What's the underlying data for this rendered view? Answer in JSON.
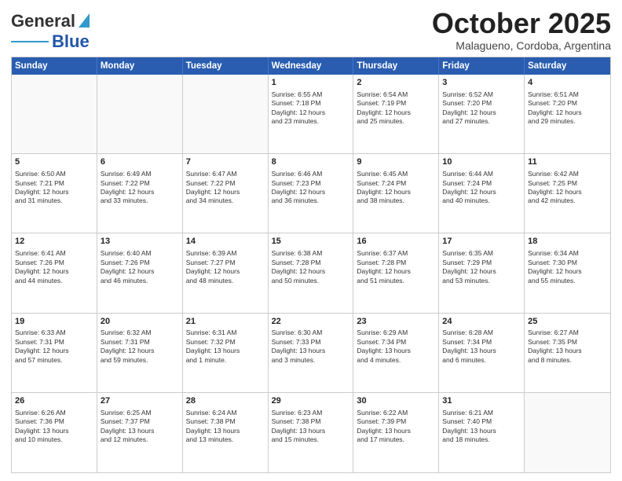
{
  "header": {
    "logo": {
      "general": "General",
      "blue": "Blue",
      "tagline": "Blue"
    },
    "title": "October 2025",
    "location": "Malagueno, Cordoba, Argentina"
  },
  "weekdays": [
    "Sunday",
    "Monday",
    "Tuesday",
    "Wednesday",
    "Thursday",
    "Friday",
    "Saturday"
  ],
  "weeks": [
    [
      {
        "day": "",
        "info": ""
      },
      {
        "day": "",
        "info": ""
      },
      {
        "day": "",
        "info": ""
      },
      {
        "day": "1",
        "info": "Sunrise: 6:55 AM\nSunset: 7:18 PM\nDaylight: 12 hours\nand 23 minutes."
      },
      {
        "day": "2",
        "info": "Sunrise: 6:54 AM\nSunset: 7:19 PM\nDaylight: 12 hours\nand 25 minutes."
      },
      {
        "day": "3",
        "info": "Sunrise: 6:52 AM\nSunset: 7:20 PM\nDaylight: 12 hours\nand 27 minutes."
      },
      {
        "day": "4",
        "info": "Sunrise: 6:51 AM\nSunset: 7:20 PM\nDaylight: 12 hours\nand 29 minutes."
      }
    ],
    [
      {
        "day": "5",
        "info": "Sunrise: 6:50 AM\nSunset: 7:21 PM\nDaylight: 12 hours\nand 31 minutes."
      },
      {
        "day": "6",
        "info": "Sunrise: 6:49 AM\nSunset: 7:22 PM\nDaylight: 12 hours\nand 33 minutes."
      },
      {
        "day": "7",
        "info": "Sunrise: 6:47 AM\nSunset: 7:22 PM\nDaylight: 12 hours\nand 34 minutes."
      },
      {
        "day": "8",
        "info": "Sunrise: 6:46 AM\nSunset: 7:23 PM\nDaylight: 12 hours\nand 36 minutes."
      },
      {
        "day": "9",
        "info": "Sunrise: 6:45 AM\nSunset: 7:24 PM\nDaylight: 12 hours\nand 38 minutes."
      },
      {
        "day": "10",
        "info": "Sunrise: 6:44 AM\nSunset: 7:24 PM\nDaylight: 12 hours\nand 40 minutes."
      },
      {
        "day": "11",
        "info": "Sunrise: 6:42 AM\nSunset: 7:25 PM\nDaylight: 12 hours\nand 42 minutes."
      }
    ],
    [
      {
        "day": "12",
        "info": "Sunrise: 6:41 AM\nSunset: 7:26 PM\nDaylight: 12 hours\nand 44 minutes."
      },
      {
        "day": "13",
        "info": "Sunrise: 6:40 AM\nSunset: 7:26 PM\nDaylight: 12 hours\nand 46 minutes."
      },
      {
        "day": "14",
        "info": "Sunrise: 6:39 AM\nSunset: 7:27 PM\nDaylight: 12 hours\nand 48 minutes."
      },
      {
        "day": "15",
        "info": "Sunrise: 6:38 AM\nSunset: 7:28 PM\nDaylight: 12 hours\nand 50 minutes."
      },
      {
        "day": "16",
        "info": "Sunrise: 6:37 AM\nSunset: 7:28 PM\nDaylight: 12 hours\nand 51 minutes."
      },
      {
        "day": "17",
        "info": "Sunrise: 6:35 AM\nSunset: 7:29 PM\nDaylight: 12 hours\nand 53 minutes."
      },
      {
        "day": "18",
        "info": "Sunrise: 6:34 AM\nSunset: 7:30 PM\nDaylight: 12 hours\nand 55 minutes."
      }
    ],
    [
      {
        "day": "19",
        "info": "Sunrise: 6:33 AM\nSunset: 7:31 PM\nDaylight: 12 hours\nand 57 minutes."
      },
      {
        "day": "20",
        "info": "Sunrise: 6:32 AM\nSunset: 7:31 PM\nDaylight: 12 hours\nand 59 minutes."
      },
      {
        "day": "21",
        "info": "Sunrise: 6:31 AM\nSunset: 7:32 PM\nDaylight: 13 hours\nand 1 minute."
      },
      {
        "day": "22",
        "info": "Sunrise: 6:30 AM\nSunset: 7:33 PM\nDaylight: 13 hours\nand 3 minutes."
      },
      {
        "day": "23",
        "info": "Sunrise: 6:29 AM\nSunset: 7:34 PM\nDaylight: 13 hours\nand 4 minutes."
      },
      {
        "day": "24",
        "info": "Sunrise: 6:28 AM\nSunset: 7:34 PM\nDaylight: 13 hours\nand 6 minutes."
      },
      {
        "day": "25",
        "info": "Sunrise: 6:27 AM\nSunset: 7:35 PM\nDaylight: 13 hours\nand 8 minutes."
      }
    ],
    [
      {
        "day": "26",
        "info": "Sunrise: 6:26 AM\nSunset: 7:36 PM\nDaylight: 13 hours\nand 10 minutes."
      },
      {
        "day": "27",
        "info": "Sunrise: 6:25 AM\nSunset: 7:37 PM\nDaylight: 13 hours\nand 12 minutes."
      },
      {
        "day": "28",
        "info": "Sunrise: 6:24 AM\nSunset: 7:38 PM\nDaylight: 13 hours\nand 13 minutes."
      },
      {
        "day": "29",
        "info": "Sunrise: 6:23 AM\nSunset: 7:38 PM\nDaylight: 13 hours\nand 15 minutes."
      },
      {
        "day": "30",
        "info": "Sunrise: 6:22 AM\nSunset: 7:39 PM\nDaylight: 13 hours\nand 17 minutes."
      },
      {
        "day": "31",
        "info": "Sunrise: 6:21 AM\nSunset: 7:40 PM\nDaylight: 13 hours\nand 18 minutes."
      },
      {
        "day": "",
        "info": ""
      }
    ]
  ]
}
